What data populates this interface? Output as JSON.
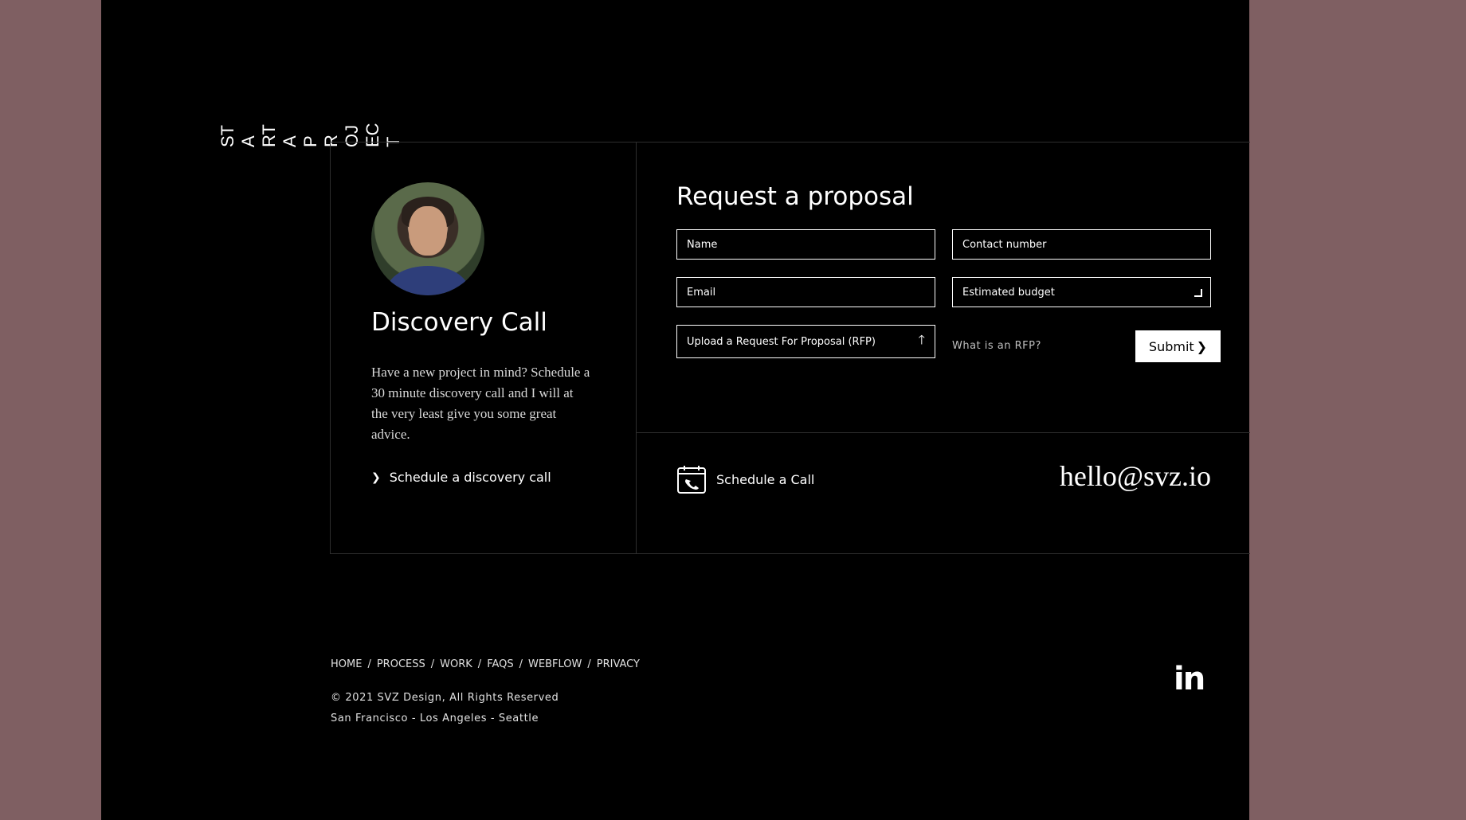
{
  "vertical_title": [
    "ST",
    "A",
    "RT",
    "A",
    "P",
    "R",
    "OJ",
    "EC",
    "T"
  ],
  "discovery": {
    "title": "Discovery Call",
    "text": "Have a new project in mind? Schedule a 30 minute discovery call and I will at the very least give you some great advice.",
    "link_label": "Schedule a discovery call"
  },
  "proposal": {
    "title": "Request a proposal",
    "name_placeholder": "Name",
    "contact_placeholder": "Contact number",
    "email_placeholder": "Email",
    "budget_placeholder": "Estimated budget",
    "upload_label": "Upload a Request For Proposal (RFP)",
    "rfp_link": "What is an RFP?",
    "submit_label": "Submit"
  },
  "contact": {
    "call_label": "Schedule a Call",
    "email": "hello@svz.io"
  },
  "footer": {
    "nav": [
      "HOME",
      "PROCESS",
      "WORK",
      "FAQS",
      "WEBFLOW",
      "PRIVACY"
    ],
    "copyright": "© 2021 SVZ Design, All Rights Reserved",
    "cities": "San Francisco - Los Angeles - Seattle",
    "social_icon": "linkedin-icon",
    "social_label": "in"
  },
  "colors": {
    "outer_background": "#7f5f62",
    "page_background": "#000000",
    "text": "#ffffff"
  }
}
